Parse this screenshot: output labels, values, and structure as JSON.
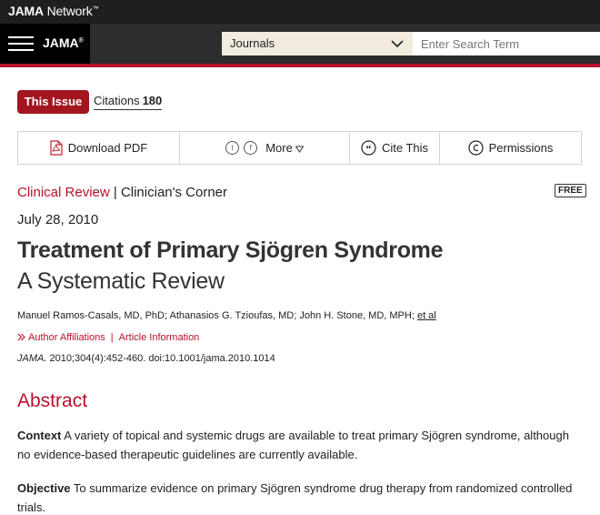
{
  "topbar": {
    "brand_bold": "JAMA",
    "brand_rest": " Network",
    "brand_mark": "™"
  },
  "header": {
    "journal_logo": "JAMA",
    "journal_mark": "®",
    "journals_label": "Journals",
    "search_placeholder": "Enter Search Term"
  },
  "issue_bar": {
    "this_issue": "This Issue",
    "citations_label": "Citations",
    "citations_count": "180"
  },
  "toolbar": {
    "download_pdf": "Download PDF",
    "more": "More",
    "cite_this": "Cite This",
    "permissions": "Permissions"
  },
  "article": {
    "type_red": "Clinical Review",
    "type_sep": " | ",
    "type_rest": "Clinician's Corner",
    "free_badge": "FREE",
    "date": "July 28, 2010",
    "title": "Treatment of Primary Sjögren Syndrome",
    "subtitle": "A Systematic Review",
    "authors": "Manuel Ramos-Casals, MD, PhD; Athanasios G. Tzioufas, MD; John H. Stone, MD, MPH; ",
    "et_al": "et al",
    "author_affiliations": "Author Affiliations",
    "article_information": "Article Information",
    "journal_abbrev": "JAMA.",
    "citation": " 2010;304(4):452-460. doi:10.1001/jama.2010.1014"
  },
  "abstract": {
    "heading": "Abstract",
    "context_label": "Context",
    "context_text": " A variety of topical and systemic drugs are available to treat primary Sjögren syndrome, although no evidence-based therapeutic guidelines are currently available.",
    "objective_label": "Objective",
    "objective_text": " To summarize evidence on primary Sjögren syndrome drug therapy from randomized controlled trials."
  },
  "colors": {
    "accent_red": "#b8112d",
    "button_red": "#a3151f",
    "header_dark": "#2d2d2d"
  },
  "icons": [
    "hamburger-icon",
    "chevron-down-icon",
    "pdf-icon",
    "twitter-icon",
    "facebook-icon",
    "triangle-down-icon",
    "quote-icon",
    "copyright-icon",
    "chevron-right-icon"
  ]
}
